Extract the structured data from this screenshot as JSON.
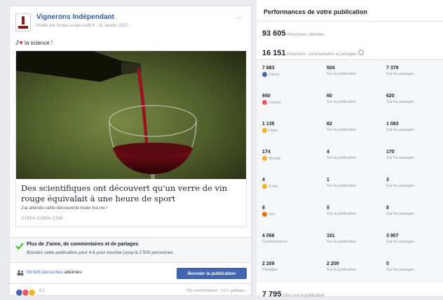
{
  "post": {
    "page_name": "Vignerons Indépendant",
    "meta": "Publié par Scopa scopa.scott.fr · 11 Janvier 2017 ·",
    "text_prefix": "J'",
    "text_suffix": " la science !",
    "link_title": "Des scientifiques ont découvert qu'un verre de vin rouge équivalait à une heure de sport",
    "link_desc": "J'ai attendu cette découverte toute ma vie !",
    "link_domain": "SYBPA.SYBPA.COM",
    "boost_title": "Plus de J'aime, de commentaires et de partages",
    "boost_sub": "Boostez cette publication pour 4 € pour toucher jusqu'à 2 500 personnes.",
    "reach_num": "93 605",
    "reach_word": " personnes",
    "reach_label": " atteintes",
    "boost_button": "Booster la publication",
    "reaction_count": "8,1",
    "comments_shares": "755 commentaires · 2,2 k partages",
    "heart_icon": "heart-icon",
    "check_icon": "check-icon",
    "people_icon": "people-icon",
    "colors": {
      "link": "#365899",
      "button": "#4267b2",
      "heart": "#e0245e",
      "check": "#42b72a"
    }
  },
  "perf": {
    "title": "Performances de votre publication",
    "reach": {
      "value": "93 605",
      "label": "Personnes atteintes"
    },
    "engagement": {
      "value": "16 151",
      "label": "Réactions, commentaires et partages"
    },
    "rows": [
      {
        "emoji": "like",
        "c1n": "7 883",
        "c1l": "J'aime",
        "c2n": "504",
        "c2l": "Sur la publication",
        "c3n": "7 379",
        "c3l": "Sur les partages"
      },
      {
        "emoji": "love",
        "c1n": "650",
        "c1l": "J'adore",
        "c2n": "60",
        "c2l": "Sur la publication",
        "c3n": "620",
        "c3l": "Sur les partages"
      },
      {
        "emoji": "haha",
        "c1n": "1 135",
        "c1l": "Haha",
        "c2n": "82",
        "c2l": "Sur la publication",
        "c3n": "1 083",
        "c3l": "Sur les partages"
      },
      {
        "emoji": "wow",
        "c1n": "174",
        "c1l": "Wouah",
        "c2n": "4",
        "c2l": "Sur la publication",
        "c3n": "170",
        "c3l": "Sur les partages"
      },
      {
        "emoji": "sad",
        "c1n": "4",
        "c1l": "Triste",
        "c2n": "1",
        "c2l": "Sur la publication",
        "c3n": "3",
        "c3l": "Sur les partages"
      },
      {
        "emoji": "angry",
        "c1n": "8",
        "c1l": "Grrr",
        "c2n": "0",
        "c2l": "Sur la publication",
        "c3n": "8",
        "c3l": "Sur les partages"
      },
      {
        "emoji": "",
        "c1n": "4 068",
        "c1l": "Commentaires",
        "c2n": "161",
        "c2l": "Sur la publication",
        "c3n": "3 907",
        "c3l": "Sur les partages"
      },
      {
        "emoji": "",
        "c1n": "2 209",
        "c1l": "Partages",
        "c2n": "2 209",
        "c2l": "Sur la publication",
        "c3n": "0",
        "c3l": "Sur les partages"
      }
    ],
    "clicks": {
      "value": "7 795",
      "label": "Clics sur la publication"
    },
    "emoji_colors": {
      "like": "#4267b2",
      "love": "#f25268",
      "haha": "#f7b125",
      "wow": "#f7b125",
      "sad": "#f7b125",
      "angry": "#e9710f"
    }
  }
}
